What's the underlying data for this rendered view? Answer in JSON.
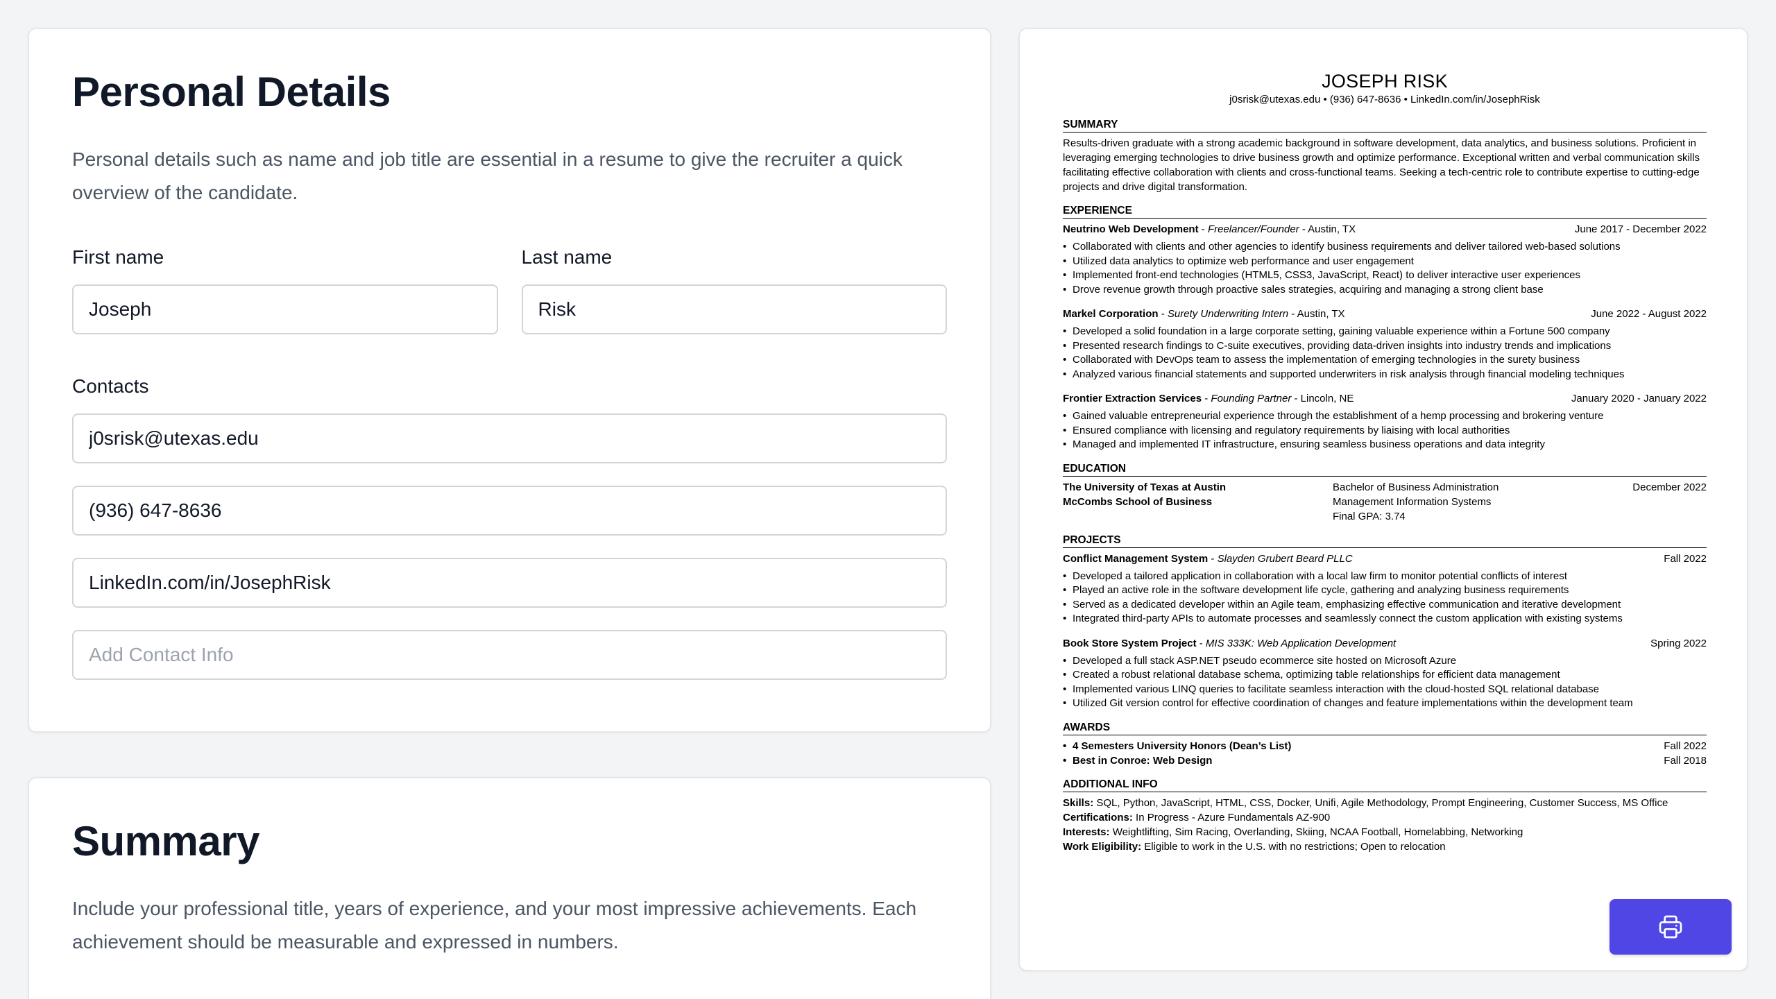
{
  "personal": {
    "title": "Personal Details",
    "description": "Personal details such as name and job title are essential in a resume to give the recruiter a quick overview of the candidate.",
    "first_name_label": "First name",
    "first_name_value": "Joseph",
    "last_name_label": "Last name",
    "last_name_value": "Risk",
    "contacts_label": "Contacts",
    "contacts": [
      "j0srisk@utexas.edu",
      "(936) 647-8636",
      "LinkedIn.com/in/JosephRisk"
    ],
    "add_contact_placeholder": "Add Contact Info"
  },
  "summary_form": {
    "title": "Summary",
    "description": "Include your professional title, years of experience, and your most impressive achievements. Each achievement should be measurable and expressed in numbers."
  },
  "resume": {
    "name": "JOSEPH RISK",
    "contact_line": "j0srisk@utexas.edu • (936) 647-8636 • LinkedIn.com/in/JosephRisk",
    "summary_title": "SUMMARY",
    "summary_text": "Results-driven graduate with a strong academic background in software development, data analytics, and business solutions. Proficient in leveraging emerging technologies to drive business growth and optimize performance. Exceptional written and verbal communication skills facilitating effective collaboration with clients and cross-functional teams. Seeking a tech-centric role to contribute expertise to cutting-edge projects and drive digital transformation.",
    "experience_title": "EXPERIENCE",
    "experience": [
      {
        "org": "Neutrino Web Development",
        "sep1": " - ",
        "role": "Freelancer/Founder",
        "location": " - Austin, TX",
        "dates": "June 2017 - December 2022",
        "bullets": [
          "Collaborated with clients and other agencies to identify business requirements and deliver tailored web-based solutions",
          "Utilized data analytics to optimize web performance and user engagement",
          "Implemented front-end technologies (HTML5, CSS3, JavaScript, React) to deliver interactive user experiences",
          "Drove revenue growth through proactive sales strategies, acquiring and managing a strong client base"
        ]
      },
      {
        "org": "Markel Corporation",
        "sep1": " - ",
        "role": "Surety Underwriting Intern",
        "location": " - Austin, TX",
        "dates": "June 2022 - August 2022",
        "bullets": [
          "Developed a solid foundation in a large corporate setting, gaining valuable experience within a Fortune 500 company",
          "Presented research findings to C-suite executives, providing data-driven insights into industry trends and implications",
          "Collaborated with DevOps team to assess the implementation of emerging technologies in the surety business",
          "Analyzed various financial statements and supported underwriters in risk analysis through financial modeling techniques"
        ]
      },
      {
        "org": "Frontier Extraction Services",
        "sep1": " - ",
        "role": "Founding Partner",
        "location": " - Lincoln, NE",
        "dates": "January 2020 - January 2022",
        "bullets": [
          "Gained valuable entrepreneurial experience through the establishment of a hemp processing and brokering venture",
          "Ensured compliance with licensing and regulatory requirements by liaising with local authorities",
          "Managed and implemented IT infrastructure, ensuring seamless business operations and data integrity"
        ]
      }
    ],
    "education_title": "EDUCATION",
    "education": {
      "school_line1": "The University of Texas at Austin",
      "school_line2": "McCombs School of Business",
      "degree_line1": "Bachelor of Business Administration",
      "degree_line2": "Management Information Systems",
      "degree_line3": "Final GPA: 3.74",
      "date": "December 2022"
    },
    "projects_title": "PROJECTS",
    "projects": [
      {
        "org": "Conflict Management System",
        "sep1": " - ",
        "role": "Slayden Grubert Beard PLLC",
        "location": "",
        "dates": "Fall 2022",
        "bullets": [
          "Developed a tailored application in collaboration with a local law firm to monitor potential conflicts of interest",
          "Played an active role in the software development life cycle, gathering and analyzing business requirements",
          "Served as a dedicated developer within an Agile team, emphasizing effective communication and iterative development",
          "Integrated third-party APIs to automate processes and seamlessly connect the custom application with existing systems"
        ]
      },
      {
        "org": "Book Store System Project",
        "sep1": " - ",
        "role": "MIS 333K: Web Application Development",
        "location": "",
        "dates": "Spring 2022",
        "bullets": [
          "Developed a full stack ASP.NET pseudo ecommerce site hosted on Microsoft Azure",
          "Created a robust relational database schema, optimizing table relationships for efficient data management",
          "Implemented various LINQ queries to facilitate seamless interaction with the cloud-hosted SQL relational database",
          "Utilized Git version control for effective coordination of changes and feature implementations within the development team"
        ]
      }
    ],
    "awards_title": "AWARDS",
    "awards": [
      {
        "name": "4 Semesters University Honors (Dean’s List)",
        "date": "Fall 2022"
      },
      {
        "name": "Best in Conroe: Web Design",
        "date": "Fall 2018"
      }
    ],
    "additional_title": "ADDITIONAL INFO",
    "additional": [
      {
        "label": "Skills:",
        "value": " SQL, Python, JavaScript, HTML, CSS, Docker, Unifi, Agile Methodology, Prompt Engineering, Customer Success, MS Office"
      },
      {
        "label": "Certifications:",
        "value": " In Progress - Azure Fundamentals AZ-900"
      },
      {
        "label": "Interests:",
        "value": " Weightlifting, Sim Racing, Overlanding, Skiing, NCAA Football, Homelabbing, Networking"
      },
      {
        "label": "Work Eligibility:",
        "value": " Eligible to work in the U.S. with no restrictions; Open to relocation"
      }
    ]
  },
  "print_button": {
    "icon": "printer-icon"
  },
  "colors": {
    "background": "#f3f4f6",
    "accent": "#4f46e5",
    "title_text": "#111827",
    "muted_text": "#4b5563",
    "input_border": "#d1d5db"
  }
}
